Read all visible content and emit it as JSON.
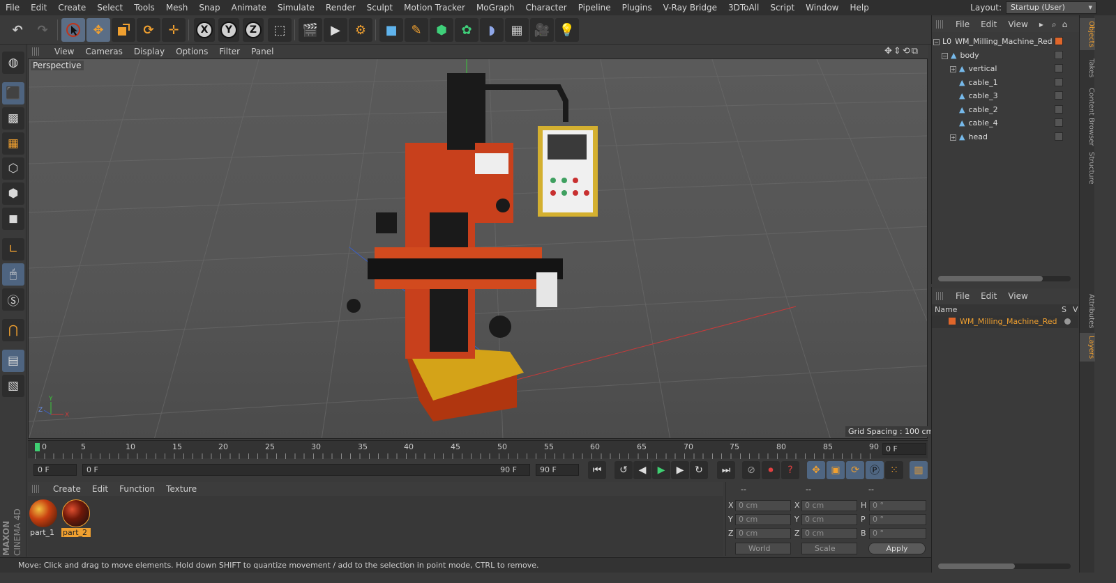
{
  "menubar": {
    "items": [
      "File",
      "Edit",
      "Create",
      "Select",
      "Tools",
      "Mesh",
      "Snap",
      "Animate",
      "Simulate",
      "Render",
      "Sculpt",
      "Motion Tracker",
      "MoGraph",
      "Character",
      "Pipeline",
      "Plugins",
      "V-Ray Bridge",
      "3DToAll",
      "Script",
      "Window",
      "Help"
    ],
    "layout_label": "Layout:",
    "layout_value": "Startup (User)"
  },
  "toolbar": {
    "axis_x": "X",
    "axis_y": "Y",
    "axis_z": "Z"
  },
  "viewport": {
    "menu": [
      "View",
      "Cameras",
      "Display",
      "Options",
      "Filter",
      "Panel"
    ],
    "label": "Perspective",
    "grid_spacing": "Grid Spacing : 100 cm",
    "axis_labels": {
      "x": "X",
      "y": "Y",
      "z": "Z"
    }
  },
  "timeline": {
    "ticks": [
      "0",
      "5",
      "10",
      "15",
      "20",
      "25",
      "30",
      "35",
      "40",
      "45",
      "50",
      "55",
      "60",
      "65",
      "70",
      "75",
      "80",
      "85",
      "90"
    ],
    "current_frame": "0 F"
  },
  "transport": {
    "start_field": "0 F",
    "range_start": "0 F",
    "range_end": "90 F",
    "end_field": "90 F"
  },
  "material_manager": {
    "menu": [
      "Create",
      "Edit",
      "Function",
      "Texture"
    ],
    "materials": [
      {
        "name": "part_1",
        "selected": false
      },
      {
        "name": "part_2",
        "selected": true
      }
    ]
  },
  "coordinates": {
    "headers": [
      "--",
      "--",
      "--"
    ],
    "rows": [
      {
        "a": "X",
        "a_val": "0 cm",
        "b": "X",
        "b_val": "0 cm",
        "c": "H",
        "c_val": "0 °"
      },
      {
        "a": "Y",
        "a_val": "0 cm",
        "b": "Y",
        "b_val": "0 cm",
        "c": "P",
        "c_val": "0 °"
      },
      {
        "a": "Z",
        "a_val": "0 cm",
        "b": "Z",
        "b_val": "0 cm",
        "c": "B",
        "c_val": "0 °"
      }
    ],
    "mode": "World",
    "transform": "Scale",
    "apply": "Apply"
  },
  "statusbar": {
    "text": "Move: Click and drag to move elements. Hold down SHIFT to quantize movement / add to the selection in point mode, CTRL to remove."
  },
  "objects_panel": {
    "menu": [
      "File",
      "Edit",
      "View"
    ],
    "tree": [
      {
        "name": "WM_Milling_Machine_Red",
        "icon": "null-object-icon"
      },
      {
        "name": "body",
        "icon": "polygon-object-icon"
      },
      {
        "name": "vertical",
        "icon": "polygon-object-icon"
      },
      {
        "name": "cable_1",
        "icon": "polygon-object-icon"
      },
      {
        "name": "cable_3",
        "icon": "polygon-object-icon"
      },
      {
        "name": "cable_2",
        "icon": "polygon-object-icon"
      },
      {
        "name": "cable_4",
        "icon": "polygon-object-icon"
      },
      {
        "name": "head",
        "icon": "polygon-object-icon"
      }
    ]
  },
  "layers_panel": {
    "menu": [
      "File",
      "Edit",
      "View"
    ],
    "col_name": "Name",
    "col_s": "S",
    "col_v": "V",
    "layer": "WM_Milling_Machine_Red"
  },
  "side_tabs": [
    "Objects",
    "Takes",
    "Content Browser",
    "Structure",
    "Attributes",
    "Layers"
  ],
  "brand": {
    "line1": "MAXON",
    "line2": "CINEMA 4D"
  },
  "colors": {
    "accent": "#f0a030",
    "selection_blue": "#5b6e86",
    "machine_red": "#c8401c"
  }
}
